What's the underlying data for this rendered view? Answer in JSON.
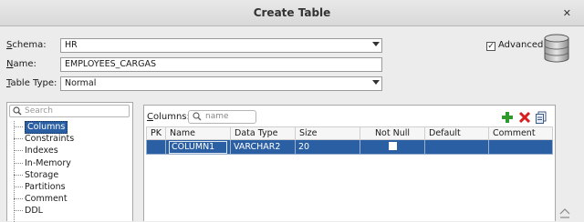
{
  "window": {
    "title": "Create Table",
    "close_glyph": "✕"
  },
  "form": {
    "schema_label": "Schema:",
    "schema_value": "HR",
    "name_label": "Name:",
    "name_value": "EMPLOYEES_CARGAS",
    "table_type_label": "Table Type:",
    "table_type_value": "Normal",
    "advanced_label": "Advanced",
    "advanced_checked": true
  },
  "sidebar": {
    "search_placeholder": "Search",
    "items": [
      {
        "label": "Columns",
        "selected": true
      },
      {
        "label": "Constraints",
        "selected": false
      },
      {
        "label": "Indexes",
        "selected": false
      },
      {
        "label": "In-Memory",
        "selected": false
      },
      {
        "label": "Storage",
        "selected": false
      },
      {
        "label": "Partitions",
        "selected": false
      },
      {
        "label": "Comment",
        "selected": false
      },
      {
        "label": "DDL",
        "selected": false
      }
    ]
  },
  "columns_panel": {
    "label": "Columns:",
    "filter_placeholder": "name",
    "headers": [
      "PK",
      "Name",
      "Data Type",
      "Size",
      "Not Null",
      "Default",
      "Comment"
    ],
    "rows": [
      {
        "pk": "",
        "name": "COLUMN1",
        "data_type": "VARCHAR2",
        "size": "20",
        "not_null": false,
        "default": "",
        "comment": ""
      }
    ],
    "tools": [
      "add-icon",
      "delete-icon",
      "copy-icon"
    ]
  },
  "colors": {
    "selection": "#2b5fa3",
    "add_green": "#2e9a2e",
    "delete_red": "#d42020"
  }
}
